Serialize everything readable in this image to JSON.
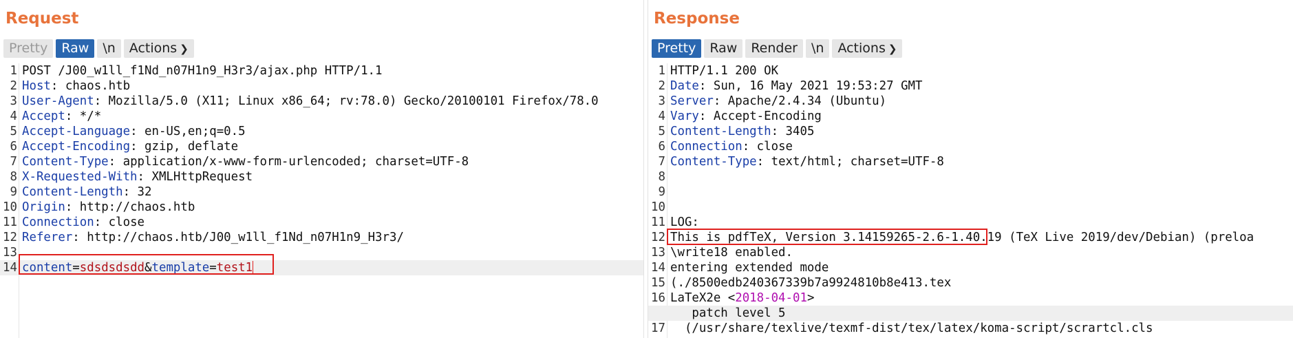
{
  "view_switch": {
    "options": [
      "split-columns-icon",
      "split-rows-icon",
      "single-pane-icon"
    ],
    "active": "split-columns-icon"
  },
  "colors": {
    "title": "#e8733b",
    "active_button": "#2a67b0",
    "header_name": "#1a3ea8",
    "param_value": "#b2131b",
    "highlight_box": "#e0201e"
  },
  "request": {
    "title": "Request",
    "toolbar": {
      "pretty": "Pretty",
      "raw": "Raw",
      "newline": "\\n",
      "actions": "Actions",
      "active": "Raw"
    },
    "lines": [
      {
        "n": "1",
        "text": "POST /J00_w1ll_f1Nd_n07H1n9_H3r3/ajax.php HTTP/1.1"
      },
      {
        "n": "2",
        "name": "Host",
        "value": " chaos.htb"
      },
      {
        "n": "3",
        "name": "User-Agent",
        "value": " Mozilla/5.0 (X11; Linux x86_64; rv:78.0) Gecko/20100101 Firefox/78.0"
      },
      {
        "n": "4",
        "name": "Accept",
        "value": " */*"
      },
      {
        "n": "5",
        "name": "Accept-Language",
        "value": " en-US,en;q=0.5"
      },
      {
        "n": "6",
        "name": "Accept-Encoding",
        "value": " gzip, deflate"
      },
      {
        "n": "7",
        "name": "Content-Type",
        "value": " application/x-www-form-urlencoded; charset=UTF-8"
      },
      {
        "n": "8",
        "name": "X-Requested-With",
        "value": " XMLHttpRequest"
      },
      {
        "n": "9",
        "name": "Content-Length",
        "value": " 32"
      },
      {
        "n": "10",
        "name": "Origin",
        "value": " http://chaos.htb"
      },
      {
        "n": "11",
        "name": "Connection",
        "value": " close"
      },
      {
        "n": "12",
        "name": "Referer",
        "value": " http://chaos.htb/J00_w1ll_f1Nd_n07H1n9_H3r3/"
      },
      {
        "n": "13",
        "text": ""
      },
      {
        "n": "14",
        "body": {
          "p1": "content",
          "eq1": "=",
          "v1": "sdsdsdsdd",
          "amp": "&",
          "p2": "template",
          "eq2": "=",
          "v2": "test1"
        }
      }
    ]
  },
  "response": {
    "title": "Response",
    "toolbar": {
      "pretty": "Pretty",
      "raw": "Raw",
      "render": "Render",
      "newline": "\\n",
      "actions": "Actions",
      "active": "Pretty"
    },
    "lines": [
      {
        "n": "1",
        "text": "HTTP/1.1 200 OK"
      },
      {
        "n": "2",
        "name": "Date",
        "value": " Sun, 16 May 2021 19:53:27 GMT"
      },
      {
        "n": "3",
        "name": "Server",
        "value": " Apache/2.4.34 (Ubuntu)"
      },
      {
        "n": "4",
        "name": "Vary",
        "value": " Accept-Encoding"
      },
      {
        "n": "5",
        "name": "Content-Length",
        "value": " 3405"
      },
      {
        "n": "6",
        "name": "Connection",
        "value": " close"
      },
      {
        "n": "7",
        "name": "Content-Type",
        "value": " text/html; charset=UTF-8"
      },
      {
        "n": "8",
        "text": ""
      },
      {
        "n": "9",
        "text": ""
      },
      {
        "n": "10",
        "text": ""
      },
      {
        "n": "11",
        "text": "LOG:"
      },
      {
        "n": "12",
        "boxed": "This is pdfTeX, Version 3.14159265-2.6-1.40.19",
        "rest": " (TeX Live 2019/dev/Debian) (preloa"
      },
      {
        "n": "13",
        "text": "\\write18 enabled."
      },
      {
        "n": "14",
        "text": "entering extended mode"
      },
      {
        "n": "15",
        "text": "(./8500edb240367339b7a9924810b8e413.tex"
      },
      {
        "n": "16",
        "pre": "LaTeX2e <",
        "date": "2018-04-01",
        "post": ">"
      },
      {
        "n": "",
        "text": "   patch level 5"
      },
      {
        "n": "17",
        "text": "  (/usr/share/texlive/texmf-dist/tex/latex/koma-script/scrartcl.cls"
      }
    ]
  }
}
